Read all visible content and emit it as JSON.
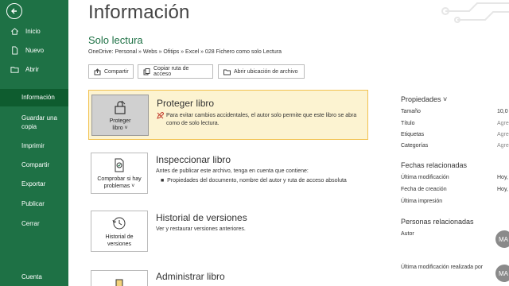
{
  "sidebar": {
    "items": [
      {
        "label": "Inicio",
        "icon": "home-icon"
      },
      {
        "label": "Nuevo",
        "icon": "new-file-icon"
      },
      {
        "label": "Abrir",
        "icon": "folder-icon"
      },
      {
        "label": "Información"
      },
      {
        "label": "Guardar una copia"
      },
      {
        "label": "Imprimir"
      },
      {
        "label": "Compartir"
      },
      {
        "label": "Exportar"
      },
      {
        "label": "Publicar"
      },
      {
        "label": "Cerrar"
      },
      {
        "label": "Cuenta"
      }
    ],
    "active": "Información"
  },
  "main": {
    "title": "Información",
    "file_name": "Solo lectura",
    "path": "OneDrive: Personal » Webs » Ofitips » Excel » 028 Fichero como solo Lectura",
    "buttons": {
      "share": "Compartir",
      "copy_path": "Copiar ruta de acceso",
      "open_location": "Abrir ubicación de archivo"
    },
    "sections": {
      "protect": {
        "tile_label_1": "Proteger",
        "tile_label_2": "libro ˅",
        "title": "Proteger libro",
        "desc": "Para evitar cambios accidentales, el autor solo permite que este libro se abra como de solo lectura."
      },
      "inspect": {
        "tile_label_1": "Comprobar si hay",
        "tile_label_2": "problemas ˅",
        "title": "Inspeccionar libro",
        "desc": "Antes de publicar este archivo, tenga en cuenta que contiene:",
        "bullet": "Propiedades del documento, nombre del autor y ruta de acceso absoluta"
      },
      "history": {
        "tile_label_1": "Historial de",
        "tile_label_2": "versiones",
        "title": "Historial de versiones",
        "desc": "Ver y restaurar versiones anteriores."
      },
      "manage": {
        "title": "Administrar libro"
      }
    }
  },
  "properties": {
    "header": "Propiedades ˅",
    "rows": [
      {
        "label": "Tamaño",
        "value": "10,0"
      },
      {
        "label": "Título",
        "value": "Agre"
      },
      {
        "label": "Etiquetas",
        "value": "Agre"
      },
      {
        "label": "Categorías",
        "value": "Agre"
      }
    ],
    "dates_header": "Fechas relacionadas",
    "dates": [
      {
        "label": "Última modificación",
        "value": "Hoy,"
      },
      {
        "label": "Fecha de creación",
        "value": "Hoy,"
      },
      {
        "label": "Última impresión",
        "value": ""
      }
    ],
    "people_header": "Personas relacionadas",
    "author_label": "Autor",
    "author_initials": "MA",
    "last_modified_by_label": "Última modificación realizada por",
    "last_modified_initials": "MA"
  },
  "colors": {
    "sidebar": "#1e7145",
    "sidebar_active": "#0e5c2f",
    "accent": "#1e7145",
    "highlight_bg": "#fcf3d1",
    "highlight_border": "#f2c14e"
  }
}
